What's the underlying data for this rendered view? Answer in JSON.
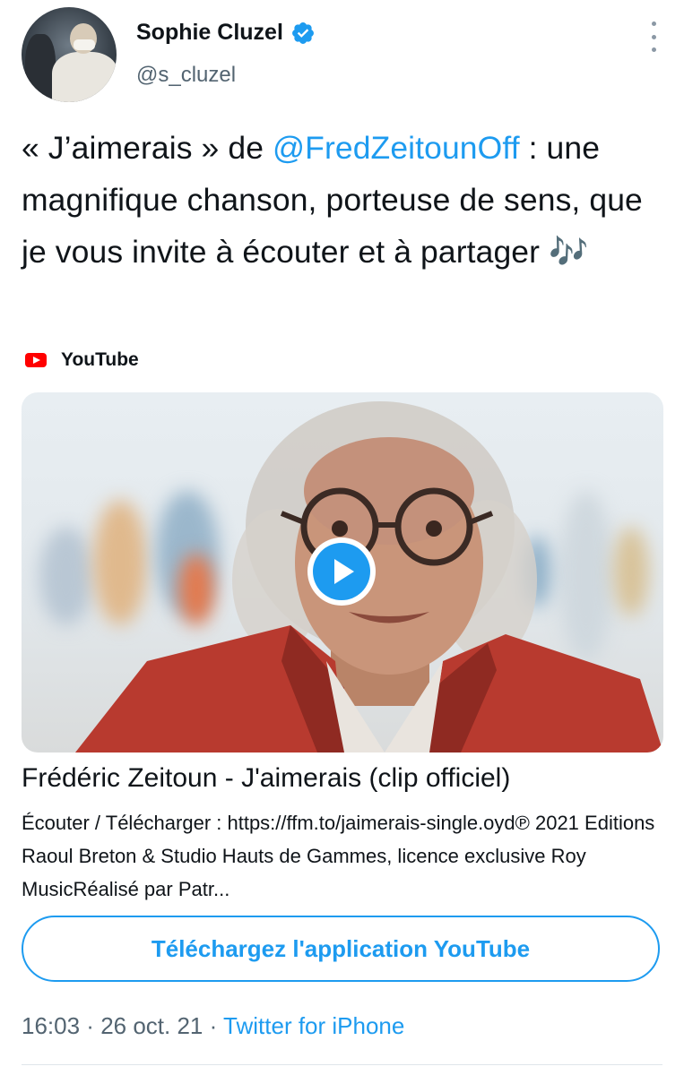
{
  "author": {
    "display_name": "Sophie Cluzel",
    "handle": "@s_cluzel"
  },
  "tweet": {
    "text_prefix": "« J’aimerais » de ",
    "mention": "@FredZeitounOff",
    "text_suffix": " : une magnifique chanson, porteuse de sens, que je vous invite à écouter et à partager ",
    "emoji": "🎶"
  },
  "card": {
    "provider": "YouTube",
    "title": "Frédéric Zeitoun - J'aimerais (clip officiel)",
    "description": "Écouter / Télécharger : https://ffm.to/jaimerais-single.oyd℗ 2021 Editions Raoul Breton & Studio Hauts de Gammes, licence exclusive Roy MusicRéalisé par Patr...",
    "cta_label": "Téléchargez l'application YouTube"
  },
  "meta": {
    "time": "16:03",
    "separator1": " · ",
    "date": "26 oct. 21",
    "separator2": " · ",
    "source": "Twitter for iPhone"
  },
  "colors": {
    "accent": "#1d9bf0",
    "youtube_red": "#ff0000",
    "secondary_text": "#536471"
  }
}
